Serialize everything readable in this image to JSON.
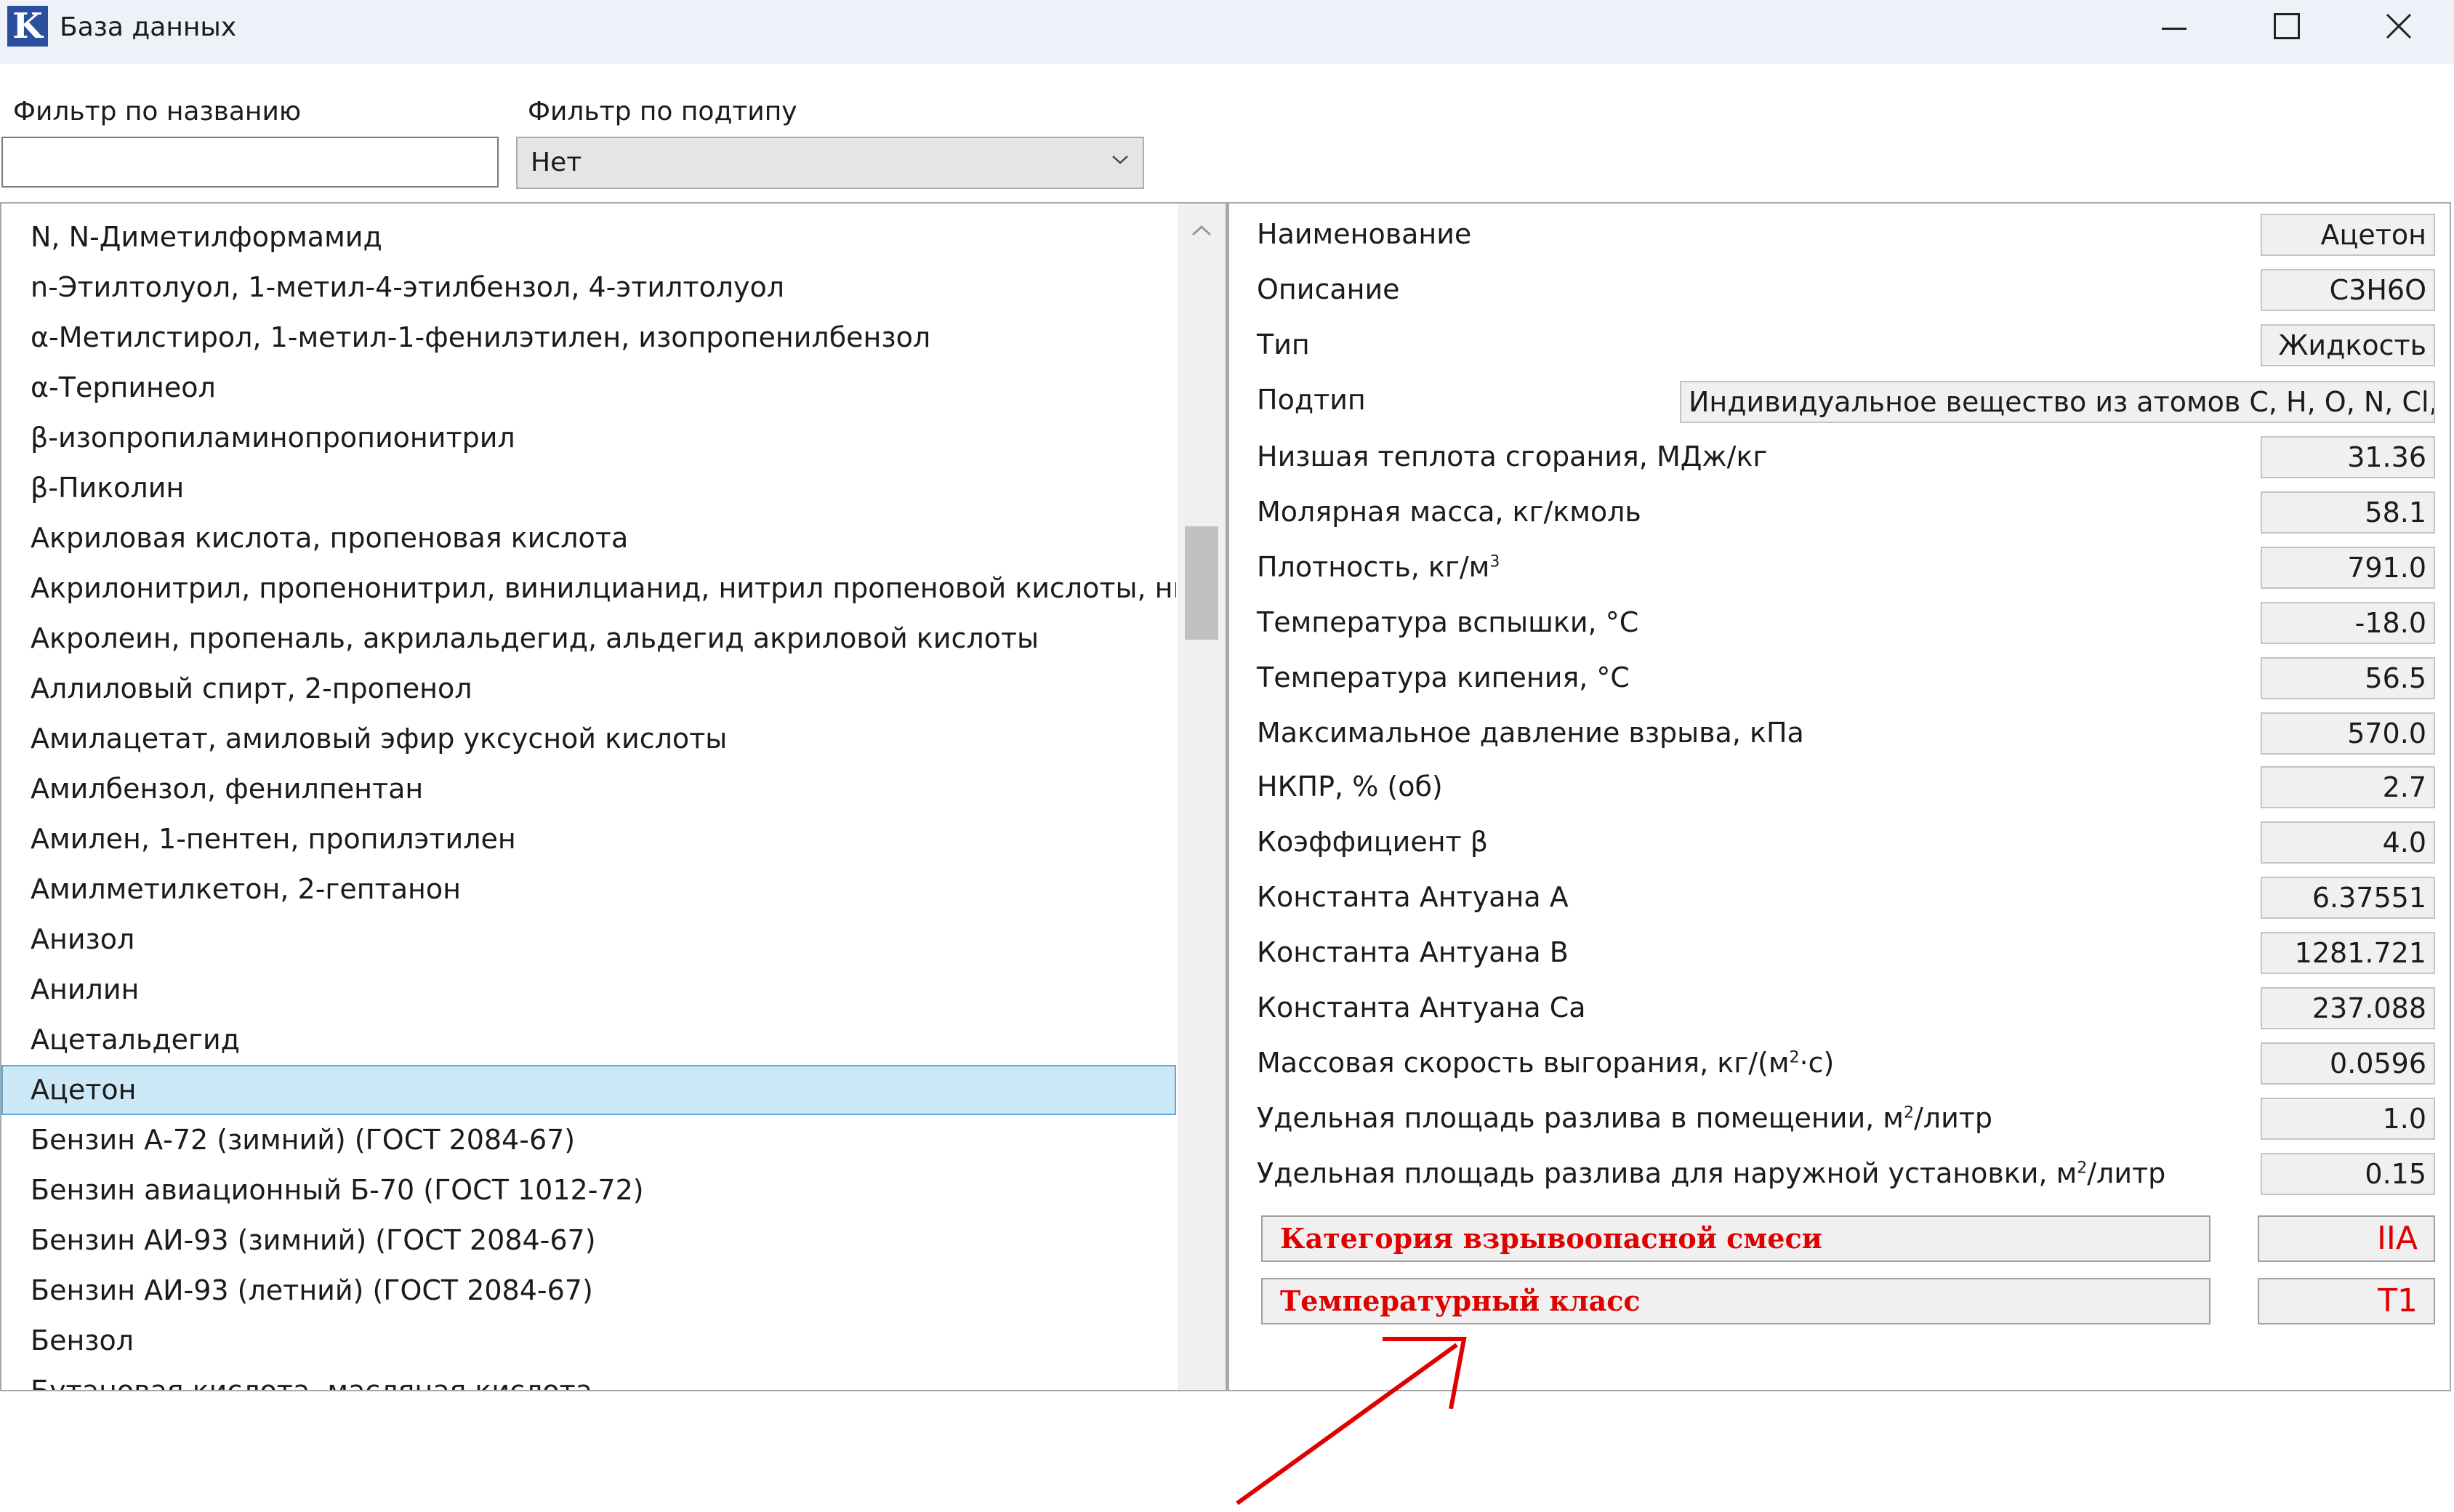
{
  "window": {
    "app_icon_letter": "K",
    "title": "База данных",
    "controls": [
      "minimize-icon",
      "maximize-icon",
      "close-icon"
    ]
  },
  "filters": {
    "name_label": "Фильтр по названию",
    "name_value": "",
    "subtype_label": "Фильтр по подтипу",
    "subtype_value": "Нет"
  },
  "list": {
    "items": [
      "N, N-Диметилформамид",
      "n-Этилтолуол, 1-метил-4-этилбензол, 4-этилтолуол",
      "α-Метилстирол, 1-метил-1-фенилэтилен, изопропенилбензол",
      "α-Терпинеол",
      "β-изопропиламинопропионитрил",
      "β-Пиколин",
      "Акриловая кислота, пропеновая кислота",
      "Акрилонитрил, пропенонитрил, винилцианид, нитрил пропеновой кислоты, нитри",
      "Акролеин, пропеналь, акрилальдегид, альдегид акриловой кислоты",
      "Аллиловый спирт, 2-пропенол",
      "Амилацетат, амиловый эфир уксусной кислоты",
      "Амилбензол, фенилпентан",
      "Амилен, 1-пентен, пропилэтилен",
      "Амилметилкетон, 2-гептанон",
      "Анизол",
      "Анилин",
      "Ацетальдегид",
      "Ацетон",
      "Бензин А-72 (зимний) (ГОСТ 2084-67)",
      "Бензин авиационный Б-70 (ГОСТ 1012-72)",
      "Бензин АИ-93 (зимний) (ГОСТ 2084-67)",
      "Бензин АИ-93 (летний) (ГОСТ 2084-67)",
      "Бензол",
      "Бутановая кислота, масляная кислота"
    ],
    "selected": "Ацетон"
  },
  "details": {
    "name_label": "Наименование",
    "name_value": "Ацетон",
    "desc_label": "Описание",
    "desc_value": "C3H6O",
    "type_label": "Тип",
    "type_value": "Жидкость",
    "subtype_label": "Подтип",
    "subtype_value": "Индивидуальное вещество из атомов C, H, O, N, Cl, Br",
    "heat_label": "Низшая теплота сгорания, МДж/кг",
    "heat_value": "31.36",
    "molar_label": "Молярная масса, кг/кмоль",
    "molar_value": "58.1",
    "density_label_pre": "Плотность, кг/м",
    "density_label_sup": "3",
    "density_value": "791.0",
    "flash_label": "Температура вспышки, °C",
    "flash_value": "-18.0",
    "boil_label": "Температура кипения, °C",
    "boil_value": "56.5",
    "pressure_label": "Максимальное давление взрыва, кПа",
    "pressure_value": "570.0",
    "lel_label": "НКПР, % (об)",
    "lel_value": "2.7",
    "beta_label": "Коэффициент β",
    "beta_value": "4.0",
    "antA_label": "Константа Антуана А",
    "antA_value": "6.37551",
    "antB_label": "Константа Антуана В",
    "antB_value": "1281.721",
    "antCa_label": "Константа Антуана Са",
    "antCa_value": "237.088",
    "burn_label_pre": "Массовая скорость выгорания, кг/(м",
    "burn_label_sup": "2",
    "burn_label_post": "·с)",
    "burn_value": "0.0596",
    "spill_in_label_pre": "Удельная площадь разлива в помещении, м",
    "spill_in_label_sup": "2",
    "spill_in_label_post": "/литр",
    "spill_in_value": "1.0",
    "spill_out_label_pre": "Удельная площадь разлива для наружной установки, м",
    "spill_out_label_sup": "2",
    "spill_out_label_post": "/литр",
    "spill_out_value": "0.15",
    "category_label": "Категория взрывоопасной смеси",
    "category_value": "IIA",
    "tempclass_label": "Температурный класс",
    "tempclass_value": "T1"
  },
  "colors": {
    "accent_red": "#e00000",
    "selection_bg": "#cce8f6",
    "selection_border": "#5aa9dc",
    "titlebar_bg": "#eef2f8"
  }
}
